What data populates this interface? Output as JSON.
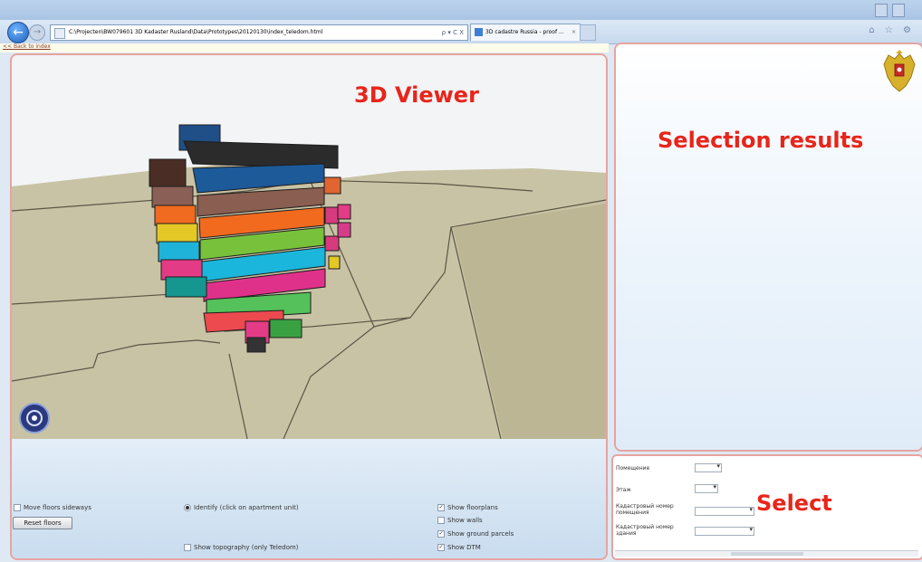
{
  "browser": {
    "address": "C:\\Projecten\\BW079601 3D Kadaster Rusland\\Data\\Prototypes\\20120130\\index_teledom.html",
    "address_controls": "ρ ▾ C X",
    "tab_title": "3D cadastre Russia - proof ...",
    "tab_close": "×",
    "back_glyph": "←",
    "forward_glyph": "→",
    "home_icons": "⌂ ☆ ⚙"
  },
  "page": {
    "back_link": "<< Back to index"
  },
  "viewer": {
    "label": "3D Viewer",
    "colors": {
      "ground": "#c9c3a5",
      "sky": "#f2f4f6",
      "accent": "#e8251a"
    }
  },
  "controls": {
    "move_floors": "Move floors sideways",
    "reset_floors": "Reset floors",
    "identify": "Identify (click on apartment unit)",
    "show_topography": "Show topography (only Teledom)",
    "show_floorplans": "Show floorplans",
    "show_walls": "Show walls",
    "show_ground_parcels": "Show ground parcels",
    "show_dtm": "Show DTM",
    "check_glyph": "✓"
  },
  "results": {
    "label": "Selection results"
  },
  "select": {
    "title": "Select",
    "field_room": "Помещение",
    "field_floor": "Этаж",
    "field_room_cadastral": "Кадастровый номер помещения",
    "field_building_cadastral": "Кадастровый номер здания"
  }
}
